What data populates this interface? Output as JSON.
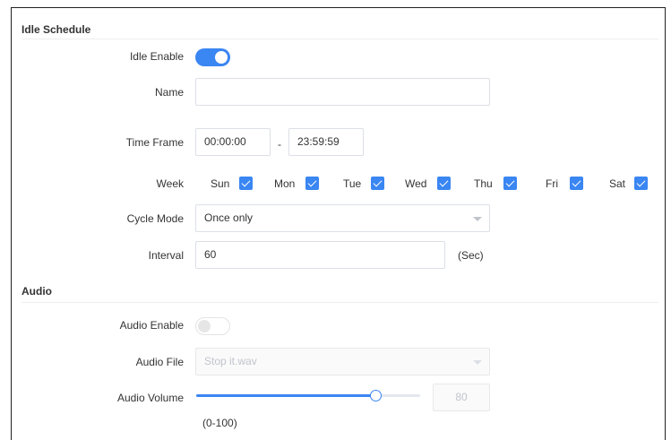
{
  "idle": {
    "section_title": "Idle Schedule",
    "enable_label": "Idle Enable",
    "enabled": true,
    "name_label": "Name",
    "name_value": "",
    "time_frame_label": "Time Frame",
    "time_start": "00:00:00",
    "time_separator": "-",
    "time_end": "23:59:59",
    "week_label": "Week",
    "days": [
      {
        "label": "Sun",
        "checked": true
      },
      {
        "label": "Mon",
        "checked": true
      },
      {
        "label": "Tue",
        "checked": true
      },
      {
        "label": "Wed",
        "checked": true
      },
      {
        "label": "Thu",
        "checked": true
      },
      {
        "label": "Fri",
        "checked": true
      },
      {
        "label": "Sat",
        "checked": true
      }
    ],
    "cycle_mode_label": "Cycle Mode",
    "cycle_mode_value": "Once only",
    "interval_label": "Interval",
    "interval_value": "60",
    "interval_unit": "(Sec)"
  },
  "audio": {
    "section_title": "Audio",
    "enable_label": "Audio Enable",
    "enabled": false,
    "file_label": "Audio File",
    "file_value": "Stop it.wav",
    "volume_label": "Audio Volume",
    "volume_value": "80",
    "volume_fraction": 0.8,
    "volume_range": "(0-100)"
  },
  "colors": {
    "accent": "#3a86f2",
    "border": "#dcdfe6",
    "disabled_text": "#c0c4cc"
  }
}
